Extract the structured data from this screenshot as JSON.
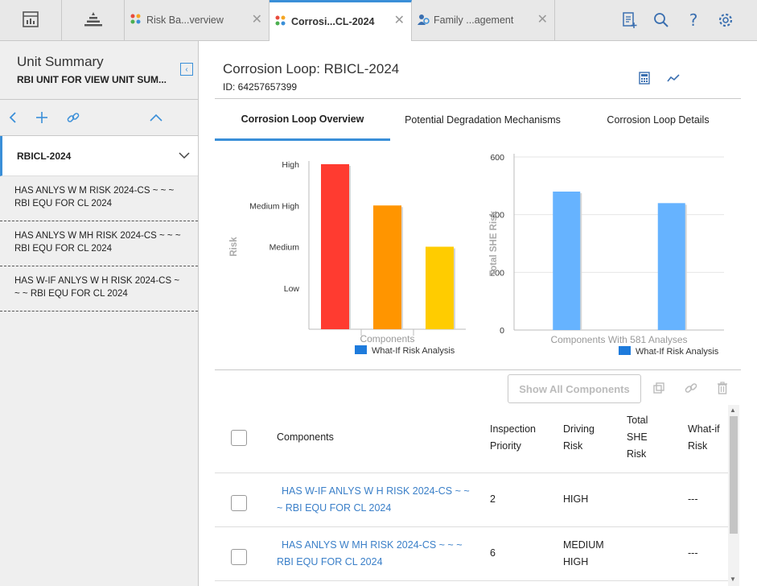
{
  "topbar": {
    "tabs": [
      {
        "label": "Risk Ba...verview",
        "close": "✕"
      },
      {
        "label": "Corrosi...CL-2024",
        "close": "✕"
      },
      {
        "label": "Family ...agement",
        "close": "✕"
      }
    ],
    "icons": [
      "dashboard-icon",
      "hierarchy-icon",
      "add-document-icon",
      "search-icon",
      "help-icon",
      "settings-icon"
    ],
    "accent": "#3a8fd8"
  },
  "sidebar": {
    "title": "Unit Summary",
    "subtitle": "RBI UNIT FOR VIEW UNIT SUM...",
    "items": [
      {
        "label": "RBICL-2024"
      },
      {
        "label": "HAS ANLYS W M RISK 2024-CS ~ ~ ~ RBI EQU FOR CL 2024"
      },
      {
        "label": "HAS ANLYS W MH RISK 2024-CS ~ ~ ~ RBI EQU FOR CL 2024"
      },
      {
        "label": "HAS W-IF ANLYS W H RISK 2024-CS ~ ~ ~ RBI EQU FOR CL 2024"
      }
    ]
  },
  "main": {
    "title": "Corrosion Loop: RBICL-2024",
    "id_label": "ID: 64257657399",
    "tabs": [
      {
        "label": "Corrosion Loop Overview"
      },
      {
        "label": "Potential Degradation Mechanisms"
      },
      {
        "label": "Corrosion Loop Details"
      }
    ],
    "show_all_label": "Show All Components",
    "grid": {
      "headers": [
        "Components",
        "Inspection Priority",
        "Driving Risk",
        "Total SHE Risk",
        "What-if Risk"
      ],
      "rows": [
        {
          "component": "HAS W-IF ANLYS W H RISK 2024-CS ~ ~ ~ RBI EQU FOR CL 2024",
          "priority": "2",
          "driving_risk": "HIGH",
          "what_if": "---"
        },
        {
          "component": "HAS ANLYS W MH RISK 2024-CS ~ ~ ~ RBI EQU FOR CL 2024",
          "priority": "6",
          "driving_risk": "MEDIUM HIGH",
          "what_if": "---"
        }
      ]
    }
  },
  "chart_data": [
    {
      "type": "bar",
      "categories": [
        "",
        "",
        ""
      ],
      "xlabel": "Components",
      "ylabel": "Risk",
      "ytick_labels": [
        "Low",
        "Medium",
        "Medium High",
        "High"
      ],
      "values": [
        4,
        3,
        2
      ],
      "colors": [
        "#ff3b30",
        "#ff9500",
        "#ffcc00"
      ],
      "legend": [
        "What-If Risk Analysis"
      ],
      "legend_color": "#1e7bdc",
      "ylim": [
        0,
        4
      ]
    },
    {
      "type": "bar",
      "categories": [
        "",
        ""
      ],
      "xlabel": "Components With 581 Analyses",
      "ylabel": "Total SHE Risk",
      "ytick_labels": [
        "0",
        "200",
        "400",
        "600"
      ],
      "values": [
        480,
        440
      ],
      "colors": [
        "#66b3ff",
        "#66b3ff"
      ],
      "legend": [
        "What-If Risk Analysis"
      ],
      "legend_color": "#1e7bdc",
      "ylim": [
        0,
        600
      ]
    }
  ]
}
